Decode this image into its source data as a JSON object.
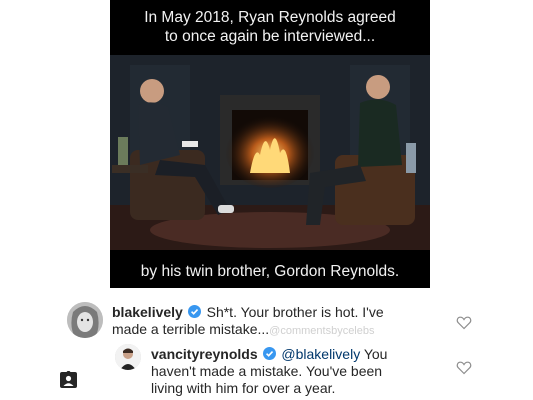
{
  "video": {
    "caption_top_line1": "In May 2018, Ryan Reynolds agreed",
    "caption_top_line2": "to once again be interviewed...",
    "caption_bottom": "by his twin brother, Gordon Reynolds."
  },
  "comments": [
    {
      "username": "blakelively",
      "text_line1": "Sh*t. Your brother is hot. I've",
      "text_line2": "made a terrible mistake...",
      "watermark": "@commentsbycelebs",
      "verified": true,
      "icons": [
        "avatar",
        "verified-badge-icon",
        "heart-icon"
      ]
    },
    {
      "username": "vancityreynolds",
      "mention": "@blakelively",
      "text_line1_rest": "You",
      "text_line2": "haven't made a mistake. You've been",
      "text_line3": "living with him for over a year.",
      "verified": true,
      "icons": [
        "avatar",
        "verified-badge-icon",
        "heart-icon"
      ]
    }
  ],
  "sidebar_icon": "person-tag-icon",
  "colors": {
    "verified": "#3897f0",
    "mention": "#00376b",
    "text": "#262626"
  }
}
